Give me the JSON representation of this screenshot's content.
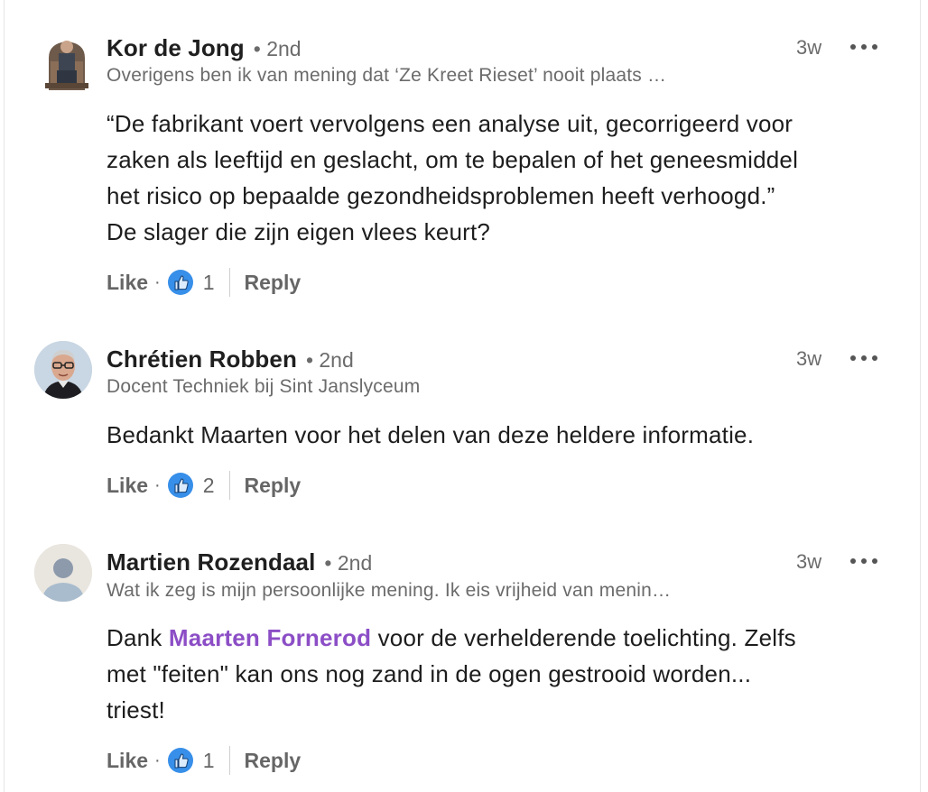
{
  "comments": [
    {
      "author": "Kor de Jong",
      "degree": "• 2nd",
      "headline": "Overigens ben ik van mening dat ‘Ze Kreet Rieset’ nooit plaats …",
      "time": "3w",
      "body_lines": [
        "“De fabrikant voert vervolgens een analyse uit, gecorrigeerd voor",
        "zaken als leeftijd en geslacht, om te bepalen of het geneesmiddel",
        "het risico op bepaalde gezondheidsproblemen heeft verhoogd.”",
        "De slager die zijn eigen vlees keurt?"
      ],
      "like_label": "Like",
      "reaction_count": "1",
      "reply_label": "Reply"
    },
    {
      "author": "Chrétien Robben",
      "degree": "• 2nd",
      "headline": "Docent Techniek bij Sint Janslyceum",
      "time": "3w",
      "body_lines": [
        "Bedankt Maarten voor het delen van deze heldere informatie."
      ],
      "like_label": "Like",
      "reaction_count": "2",
      "reply_label": "Reply"
    },
    {
      "author": "Martien Rozendaal",
      "degree": "• 2nd",
      "headline": "Wat ik zeg is mijn persoonlijke mening. Ik eis vrijheid van menin…",
      "time": "3w",
      "body_prefix": "Dank ",
      "mention": "Maarten Fornerod",
      "body_suffix_line1": " voor de verhelderende toelichting. Zelfs",
      "body_lines_rest": [
        "met \"feiten\" kan ons nog zand in de ogen gestrooid worden...",
        "triest!"
      ],
      "like_label": "Like",
      "reaction_count": "1",
      "reply_label": "Reply"
    }
  ],
  "colors": {
    "mention": "#8c4ec6",
    "like_blue": "#378fe9",
    "muted_text": "#6b6b6b"
  },
  "icons": {
    "like": "thumbs-up-icon",
    "more": "more-horizontal-icon"
  }
}
